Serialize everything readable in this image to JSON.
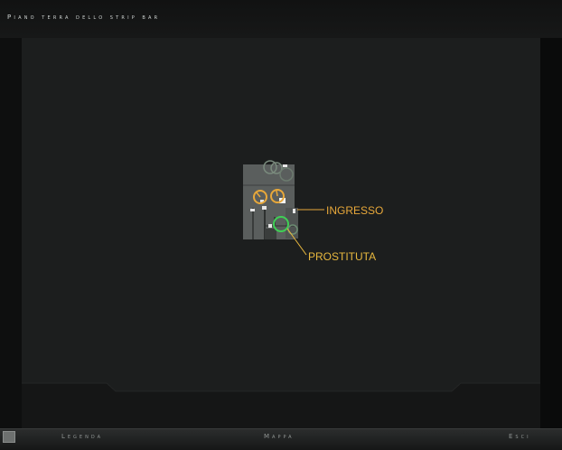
{
  "window": {
    "title": "Piano terra dello strip bar"
  },
  "map": {
    "labels": [
      {
        "id": "ingresso",
        "text": "INGRESSO",
        "color": "#e8a83a"
      },
      {
        "id": "prostituta",
        "text": "PROSTITUTA",
        "color": "#e8b83e"
      }
    ],
    "colors": {
      "background": "#1c1e1e",
      "building": "#5a5e5d",
      "objective_marker": "#e8a83a",
      "npc_marker": "#3fcf55",
      "faded_marker": "#7a8a7d"
    }
  },
  "footer": {
    "legend_label": "Legenda",
    "map_label": "Mappa",
    "exit_label": "Esci"
  }
}
